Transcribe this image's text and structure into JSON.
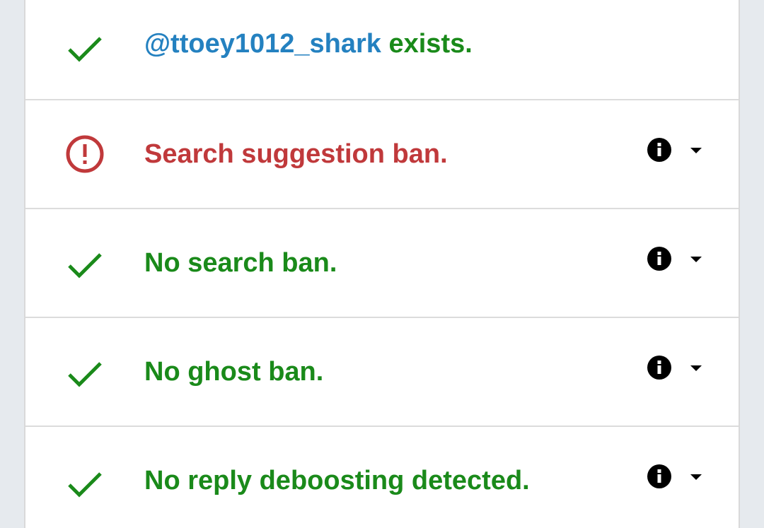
{
  "colors": {
    "ok": "#1a8a1a",
    "ban": "#c0393b",
    "handle": "#2481c0",
    "icon": "#000000"
  },
  "rows": [
    {
      "status": "ok",
      "icon": "checkmark-icon",
      "handle": "@ttoey1012_shark",
      "text": " exists.",
      "has_info": false
    },
    {
      "status": "ban",
      "icon": "alert-circle-icon",
      "text": "Search suggestion ban.",
      "has_info": true,
      "info_icon": "info-icon",
      "expand_icon": "caret-down-icon"
    },
    {
      "status": "ok",
      "icon": "checkmark-icon",
      "text": "No search ban.",
      "has_info": true,
      "info_icon": "info-icon",
      "expand_icon": "caret-down-icon"
    },
    {
      "status": "ok",
      "icon": "checkmark-icon",
      "text": "No ghost ban.",
      "has_info": true,
      "info_icon": "info-icon",
      "expand_icon": "caret-down-icon"
    },
    {
      "status": "ok",
      "icon": "checkmark-icon",
      "text": "No reply deboosting detected.",
      "has_info": true,
      "info_icon": "info-icon",
      "expand_icon": "caret-down-icon"
    }
  ]
}
